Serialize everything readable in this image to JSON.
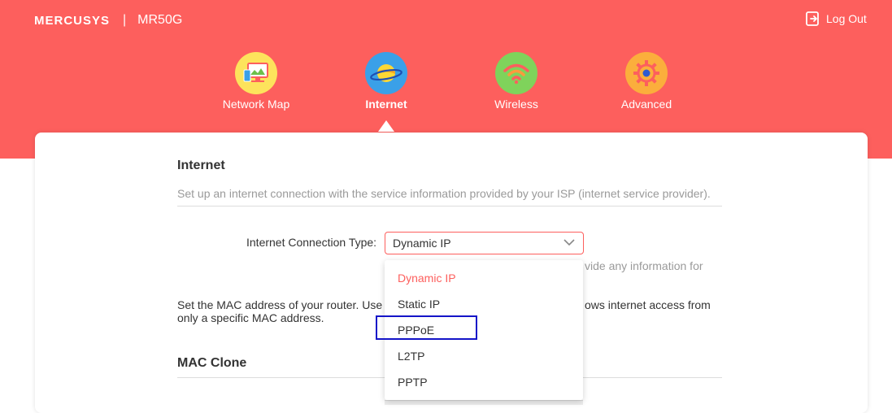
{
  "header": {
    "brand": "MERCUSYS",
    "separator": "|",
    "model": "MR50G",
    "logout_label": "Log Out"
  },
  "nav": [
    {
      "label": "Network Map",
      "icon": "network-map-icon",
      "active": false
    },
    {
      "label": "Internet",
      "icon": "internet-planet-icon",
      "active": true
    },
    {
      "label": "Wireless",
      "icon": "wifi-icon",
      "active": false
    },
    {
      "label": "Advanced",
      "icon": "gear-icon",
      "active": false
    }
  ],
  "internet_section": {
    "title": "Internet",
    "description": "Set up an internet connection with the service information provided by your ISP (internet service provider).",
    "connection_type_label": "Internet Connection Type:",
    "connection_type_value": "Dynamic IP",
    "hint_partial": "vide any information for"
  },
  "mac_section": {
    "text_left_line1": "Set the MAC address of your router. Use",
    "text_right_line1": "ows internet access from",
    "text_line2": "only a specific MAC address.",
    "title": "MAC Clone"
  },
  "dropdown": {
    "options": [
      "Dynamic IP",
      "Static IP",
      "PPPoE",
      "L2TP",
      "PPTP"
    ],
    "selected": "Dynamic IP",
    "highlighted": "PPPoE"
  },
  "colors": {
    "brand": "#fd5f5d",
    "highlight_box": "#1414c8"
  }
}
